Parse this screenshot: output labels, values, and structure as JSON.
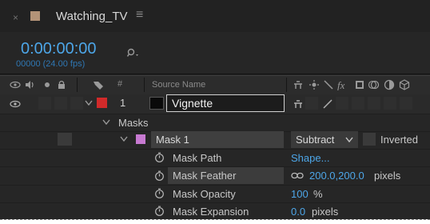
{
  "composition": {
    "tab_close": "×",
    "tab_title": "Watching_TV",
    "tab_menu": "≡",
    "timecode": "0:00:00:00",
    "frame_info": "00000 (24.00 fps)",
    "search_icon": "search-icon"
  },
  "header": {
    "col_source_name": "Source Name",
    "hash_symbol": "#"
  },
  "layer": {
    "number": "1",
    "name": "Vignette",
    "label_color": "#d12a2a"
  },
  "masks_group": {
    "label": "Masks"
  },
  "mask": {
    "name": "Mask 1",
    "color": "#c77ad1",
    "mode": "Subtract",
    "inverted_label": "Inverted"
  },
  "properties": [
    {
      "label": "Mask Path",
      "value": "Shape..."
    },
    {
      "label": "Mask Feather",
      "value": "200.0,200.0",
      "unit": "pixels"
    },
    {
      "label": "Mask Opacity",
      "value": "100",
      "unit": "%"
    },
    {
      "label": "Mask Expansion",
      "value": "0.0",
      "unit": "pixels"
    }
  ]
}
